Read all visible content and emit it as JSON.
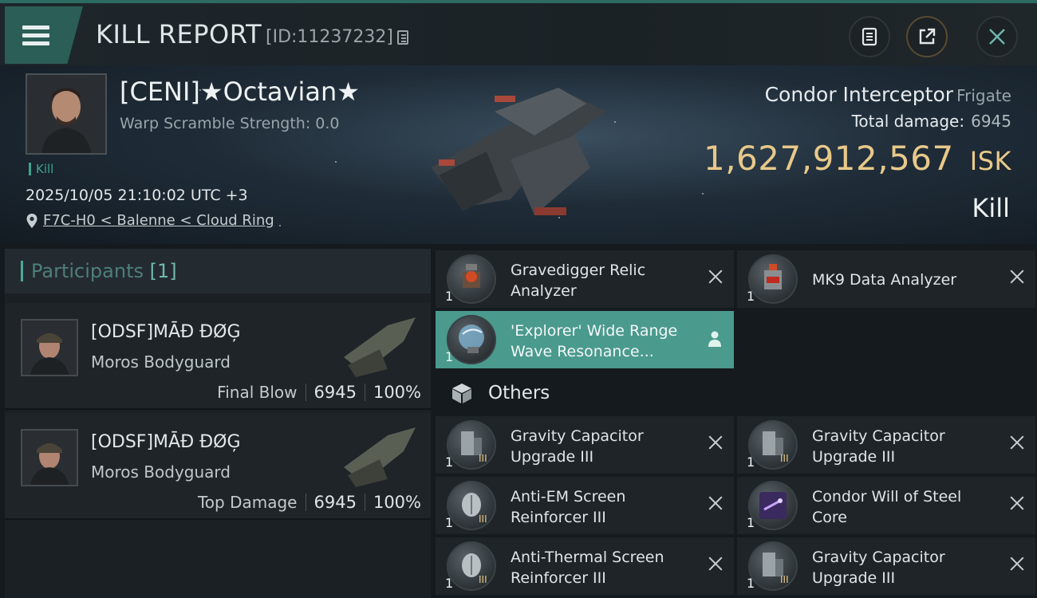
{
  "header": {
    "title": "KILL REPORT",
    "report_id": "[ID:11237232]"
  },
  "victim": {
    "pilot_name": "[CENI]★Octavian★",
    "warp_scramble": "Warp Scramble Strength: 0.0",
    "kill_tag": "Kill",
    "datetime": "2025/10/05 21:10:02 UTC +3",
    "location": "F7C-H0 < Balenne < Cloud Ring",
    "ship_name": "Condor Interceptor",
    "ship_class": "Frigate",
    "total_damage_label": "Total damage:",
    "total_damage_value": "6945",
    "isk_value": "1,627,912,567",
    "isk_unit": "ISK",
    "result": "Kill"
  },
  "participants": {
    "label": "Participants",
    "count": "[1]",
    "cards": [
      {
        "name": "[ODSF]MĀĐ ĐØĢ",
        "ship": "Moros Bodyguard",
        "role": "Final Blow",
        "damage": "6945",
        "percent": "100%"
      },
      {
        "name": "[ODSF]MĀĐ ĐØĢ",
        "ship": "Moros Bodyguard",
        "role": "Top Damage",
        "damage": "6945",
        "percent": "100%"
      }
    ]
  },
  "items": {
    "top": [
      {
        "name": "Gravedigger Relic Analyzer",
        "qty": "1",
        "icon": "relic-analyzer-icon"
      },
      {
        "name": "MK9 Data Analyzer",
        "qty": "1",
        "icon": "data-analyzer-icon"
      },
      {
        "name": "'Explorer' Wide Range Wave Resonance...",
        "qty": "1",
        "icon": "scanner-icon"
      }
    ],
    "others_label": "Others",
    "others": [
      {
        "name": "Gravity Capacitor Upgrade III",
        "qty": "1",
        "icon": "capacitor-upgrade-icon"
      },
      {
        "name": "Gravity Capacitor Upgrade III",
        "qty": "1",
        "icon": "capacitor-upgrade-icon"
      },
      {
        "name": "Anti-EM Screen Reinforcer III",
        "qty": "1",
        "icon": "shield-rig-icon"
      },
      {
        "name": "Condor Will of Steel Core",
        "qty": "1",
        "icon": "core-icon"
      },
      {
        "name": "Anti-Thermal Screen Reinforcer III",
        "qty": "1",
        "icon": "shield-rig-icon"
      },
      {
        "name": "Gravity Capacitor Upgrade III",
        "qty": "1",
        "icon": "capacitor-upgrade-icon"
      }
    ]
  },
  "colors": {
    "accent": "#2a5e56",
    "selected_row": "#4a9a8e",
    "isk": "#e8c98a"
  }
}
